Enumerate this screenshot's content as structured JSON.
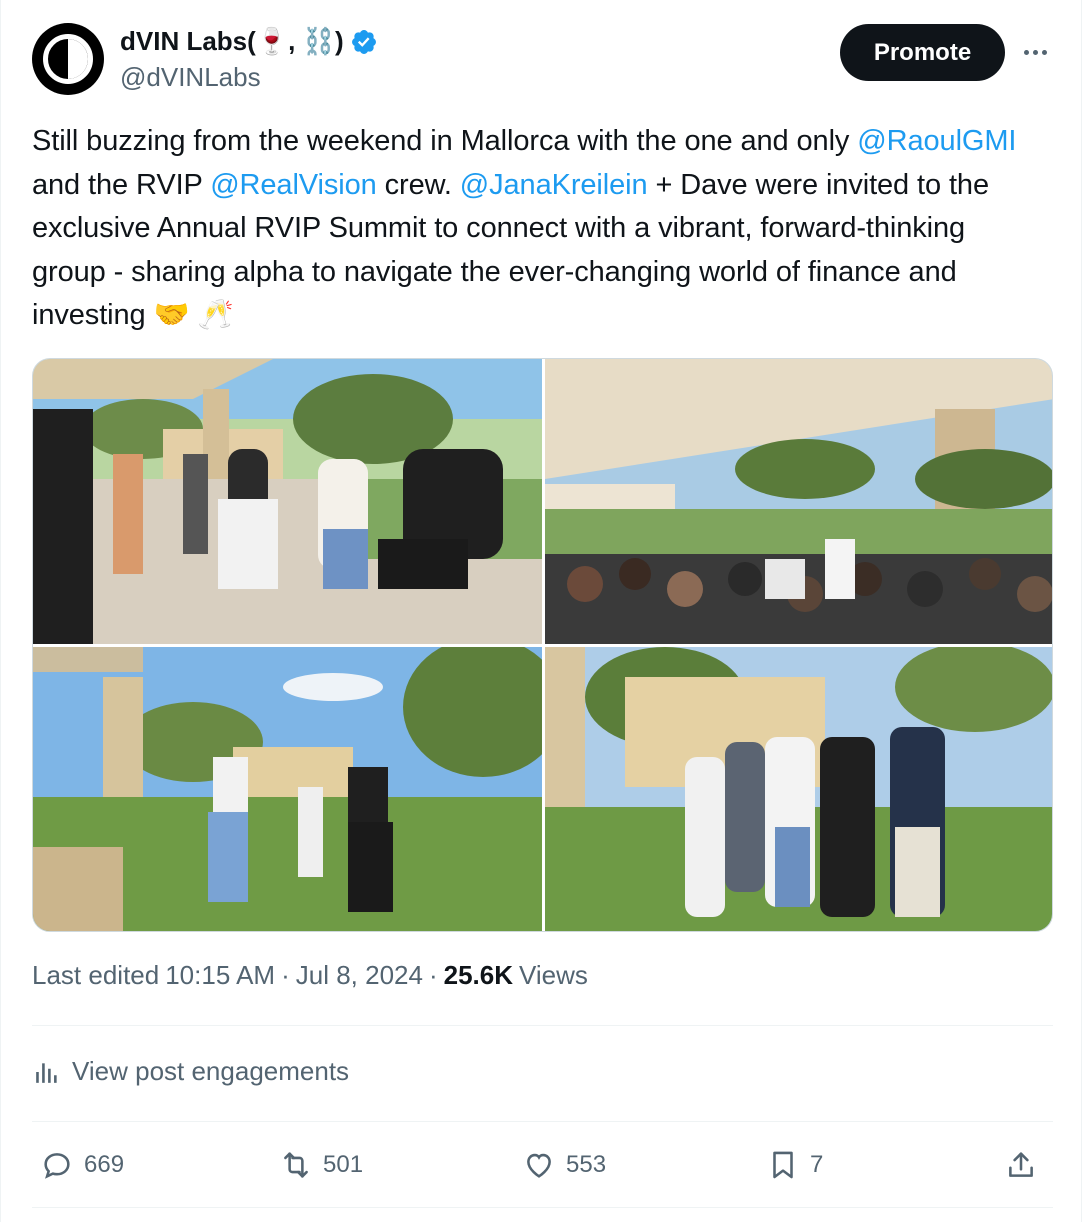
{
  "author": {
    "display_name": "dVIN Labs(🍷, ⛓️)",
    "handle": "@dVINLabs",
    "verified": true
  },
  "header": {
    "promote_label": "Promote",
    "more_icon": "more-horizontal-icon"
  },
  "tweet": {
    "t1": "Still buzzing from the weekend in Mallorca with the one and only ",
    "m1": "@RaoulGMI",
    "t2": " and the RVIP ",
    "m2": "@RealVision",
    "t3": " crew. ",
    "m3": "@JanaKreilein",
    "t4": " + Dave were invited to the exclusive Annual RVIP Summit to connect with a vibrant, forward-thinking group - sharing alpha to navigate the ever-changing world of finance and investing 🤝 🥂"
  },
  "meta": {
    "edited_prefix": "Last edited",
    "time": "10:15 AM",
    "sep1": "·",
    "date": "Jul 8, 2024",
    "sep2": "·",
    "views_count": "25.6K",
    "views_label": "Views"
  },
  "engagements": {
    "label": "View post engagements",
    "icon": "analytics-icon"
  },
  "actions": {
    "replies": "669",
    "reposts": "501",
    "likes": "553",
    "bookmarks": "7"
  },
  "colors": {
    "link": "#1d9bf0",
    "text": "#0f1419",
    "secondary": "#536471",
    "button_bg": "#0f1419"
  }
}
